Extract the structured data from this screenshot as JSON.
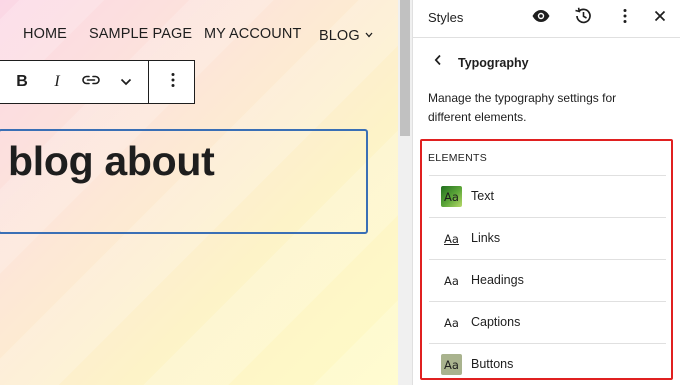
{
  "nav": {
    "items": [
      "HOME",
      "SAMPLE PAGE",
      "MY ACCOUNT",
      "BLOG"
    ]
  },
  "toolbar": {
    "bold_label": "B",
    "italic_label": "I"
  },
  "editor": {
    "heading_text": "blog about"
  },
  "panel": {
    "title": "Styles",
    "section_title": "Typography",
    "description": "Manage the typography settings for different elements.",
    "elements_label": "ELEMENTS",
    "elements": [
      {
        "label": "Text",
        "preview": "Aa",
        "style": "gradient-swatch"
      },
      {
        "label": "Links",
        "preview": "Aa",
        "style": "underlined"
      },
      {
        "label": "Headings",
        "preview": "Aa",
        "style": "plain"
      },
      {
        "label": "Captions",
        "preview": "Aa",
        "style": "plain"
      },
      {
        "label": "Buttons",
        "preview": "Aa",
        "style": "muted-swatch"
      }
    ]
  },
  "colors": {
    "highlight_border": "#e02020",
    "selection_border": "#3a6fb5"
  },
  "icons": [
    "chevron-down-icon",
    "link-icon",
    "more-vertical-icon",
    "eye-icon",
    "history-icon",
    "close-icon",
    "chevron-left-icon"
  ]
}
